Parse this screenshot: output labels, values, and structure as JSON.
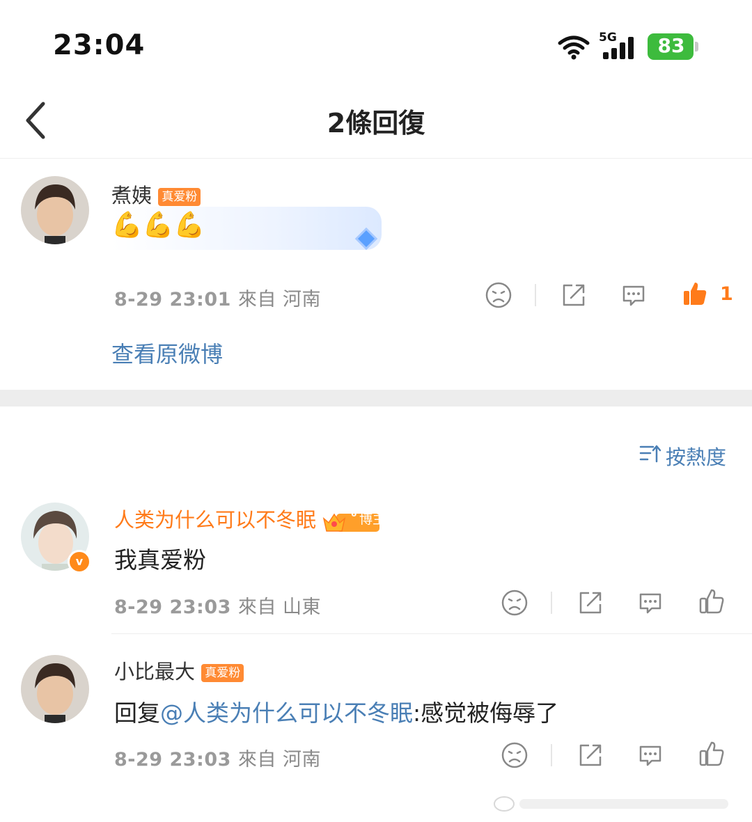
{
  "status_bar": {
    "time": "23:04",
    "network": "5G",
    "battery": "83"
  },
  "header": {
    "title": "2條回復"
  },
  "root_comment": {
    "username": "煮姨",
    "badge": "真爱粉",
    "content_emoji": "💪💪💪",
    "date": "8-29 23:01",
    "location": "來自 河南",
    "like_count": "1",
    "view_original": "查看原微博"
  },
  "sort": {
    "label": "按熱度"
  },
  "replies": [
    {
      "username": "人类为什么可以不冬眠",
      "badge": "博主",
      "badge_level": "6",
      "text": "我真爱粉",
      "date": "8-29 23:03",
      "location": "來自 山東"
    },
    {
      "username": "小比最大",
      "badge": "真爱粉",
      "text_prefix": "回复",
      "mention": "@人类为什么可以不冬眠",
      "text_suffix": ":感觉被侮辱了",
      "date": "8-29 23:03",
      "location": "來自 河南"
    }
  ],
  "colors": {
    "accent_orange": "#ff7b1a",
    "link_blue": "#4a7fb5",
    "battery_green": "#3dbb3d"
  }
}
